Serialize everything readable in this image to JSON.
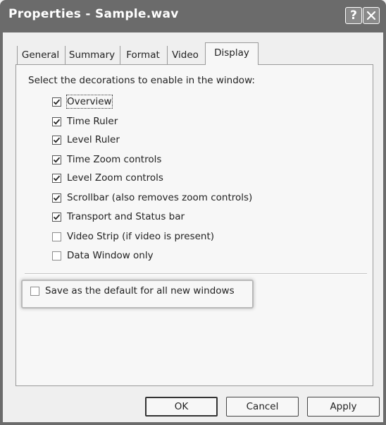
{
  "window": {
    "title": "Properties - Sample.wav",
    "help_button": "?"
  },
  "tabs": [
    {
      "label": "General",
      "active": false
    },
    {
      "label": "Summary",
      "active": false
    },
    {
      "label": "Format",
      "active": false
    },
    {
      "label": "Video",
      "active": false
    },
    {
      "label": "Display",
      "active": true
    }
  ],
  "panel": {
    "heading": "Select the decorations to enable in the window:",
    "options": [
      {
        "text": "Overview",
        "checked": true,
        "focused": true
      },
      {
        "text": "Time Ruler",
        "checked": true
      },
      {
        "text": "Level Ruler",
        "checked": true
      },
      {
        "text": "Time Zoom controls",
        "checked": true
      },
      {
        "text": "Level Zoom controls",
        "checked": true
      },
      {
        "text": "Scrollbar (also removes zoom controls)",
        "checked": true
      },
      {
        "text": "Transport and Status bar",
        "checked": true
      },
      {
        "text": "Video Strip (if video is present)",
        "checked": false
      },
      {
        "text": "Data Window only",
        "checked": false
      }
    ],
    "default_option": {
      "text": "Save as the default for all new windows",
      "checked": false
    }
  },
  "buttons": {
    "ok": "OK",
    "cancel": "Cancel",
    "apply": "Apply"
  }
}
